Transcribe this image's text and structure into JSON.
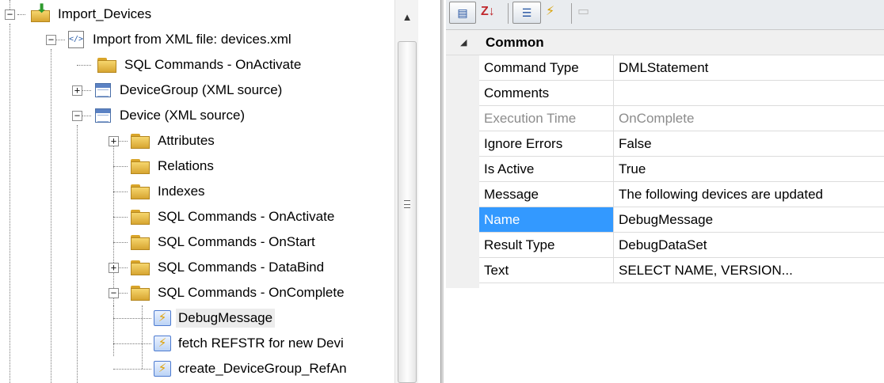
{
  "tree": {
    "items": [
      {
        "label": "Import_Devices",
        "icon": "import-folder-icon",
        "expander": "minus"
      },
      {
        "label": "Import from XML file: devices.xml",
        "icon": "xml-file-icon",
        "expander": "minus"
      },
      {
        "label": "SQL Commands - OnActivate",
        "icon": "folder-icon",
        "expander": ""
      },
      {
        "label": "DeviceGroup (XML source)",
        "icon": "table-icon",
        "expander": "plus"
      },
      {
        "label": "Device (XML source)",
        "icon": "table-icon",
        "expander": "minus"
      },
      {
        "label": "Attributes",
        "icon": "folder-icon",
        "expander": "plus"
      },
      {
        "label": "Relations",
        "icon": "folder-icon",
        "expander": ""
      },
      {
        "label": "Indexes",
        "icon": "folder-icon",
        "expander": ""
      },
      {
        "label": "SQL Commands - OnActivate",
        "icon": "folder-icon",
        "expander": ""
      },
      {
        "label": "SQL Commands - OnStart",
        "icon": "folder-icon",
        "expander": ""
      },
      {
        "label": "SQL Commands - DataBind",
        "icon": "folder-icon",
        "expander": "plus"
      },
      {
        "label": "SQL Commands - OnComplete",
        "icon": "folder-icon",
        "expander": "minus"
      },
      {
        "label": "DebugMessage",
        "icon": "sql-command-icon",
        "expander": "",
        "selected": true
      },
      {
        "label": "fetch REFSTR for new Devi",
        "icon": "sql-command-icon",
        "expander": ""
      },
      {
        "label": "create_DeviceGroup_RefAn",
        "icon": "sql-command-icon",
        "expander": ""
      }
    ]
  },
  "properties": {
    "category": "Common",
    "rows": [
      {
        "name": "Command Type",
        "value": "DMLStatement"
      },
      {
        "name": "Comments",
        "value": ""
      },
      {
        "name": "Execution Time",
        "value": "OnComplete",
        "disabled": true
      },
      {
        "name": "Ignore Errors",
        "value": "False"
      },
      {
        "name": "Is Active",
        "value": "True"
      },
      {
        "name": "Message",
        "value": "The following devices are updated"
      },
      {
        "name": "Name",
        "value": "DebugMessage",
        "selected": true
      },
      {
        "name": "Result Type",
        "value": "DebugDataSet"
      },
      {
        "name": "Text",
        "value": "SELECT NAME, VERSION..."
      }
    ]
  },
  "colors": {
    "selection": "#3399ff",
    "category_bg": "#f0f0f0",
    "disabled_text": "#8c8c8c"
  }
}
